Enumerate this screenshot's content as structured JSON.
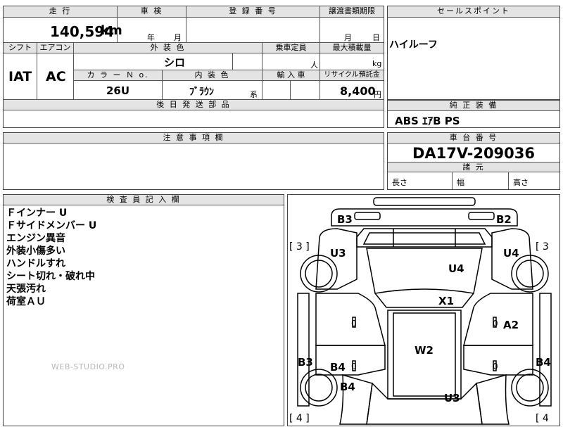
{
  "top": {
    "mileage_label": "走 行",
    "mileage_value": "140,594",
    "mileage_unit": "km",
    "inspection_label": "車 検",
    "inspection_year": "年",
    "inspection_month": "月",
    "registration_label": "登 録 番 号",
    "transfer_label": "譲渡書類期限",
    "transfer_month": "月",
    "transfer_day": "日"
  },
  "middle": {
    "shift_label": "シフト",
    "ac_label": "エアコン",
    "exterior_label": "外 装 色",
    "capacity_label": "乗車定員",
    "loadcap_label": "最大積載量",
    "shift_value": "IAT",
    "ac_value": "AC",
    "exterior_value": "シロ",
    "capacity_unit": "人",
    "loadcap_unit": "kg",
    "color_no_label": "カ ラ ー Ｎ o.",
    "interior_label": "内 装 色",
    "import_label": "輸 入 車",
    "recycle_label": "リサイクル預託金",
    "color_no_value": "26U",
    "interior_value": "ﾌﾞﾗｳﾝ",
    "interior_suffix": "系",
    "recycle_value": "8,400",
    "recycle_unit": "円",
    "later_parts_label": "後 日 発 送 部 品"
  },
  "right": {
    "sales_label": "セールスポイント",
    "sales_value": "ハイルーフ",
    "equip_label": "純 正 装 備",
    "equip_value": "ABS ｴｱB PS",
    "chassis_label": "車 台 番 号",
    "chassis_value": "DA17V-209036",
    "dims_label": "諸 元",
    "length_label": "長さ",
    "width_label": "幅",
    "height_label": "高さ"
  },
  "notes": {
    "caution_label": "注 意 事 項 欄",
    "inspector_label": "検 査 員 記 入 欄",
    "lines": [
      "Ｆインナー U",
      "Ｆサイドメンバー U",
      "エンジン異音",
      "外装小傷多い",
      "ハンドルすれ",
      "シート切れ・破れ中",
      "天張汚れ",
      "荷室ＡＵ"
    ],
    "watermark": "WEB-STUDIO.PRO"
  },
  "diagram": {
    "labels": {
      "b3_top": "B3",
      "b2_top": "B2",
      "bracket_left_top": "[ 3 ]",
      "bracket_right_top": "[ 3",
      "u3_left": "U3",
      "u4_right": "U4",
      "u4_center": "U4",
      "x1": "X1",
      "a2": "A2",
      "zero_left": "0",
      "zero_right": "0",
      "w2": "W2",
      "b3_left": "B3",
      "b4_left_a": "B4",
      "b4_left_b": "B4",
      "b4_right": "B4",
      "zero_left_low": "0",
      "zero_right_low": "0",
      "u3_bottom": "U3",
      "bracket_left_bottom": "[ 4 ]",
      "bracket_right_bottom": "[ 4"
    }
  }
}
